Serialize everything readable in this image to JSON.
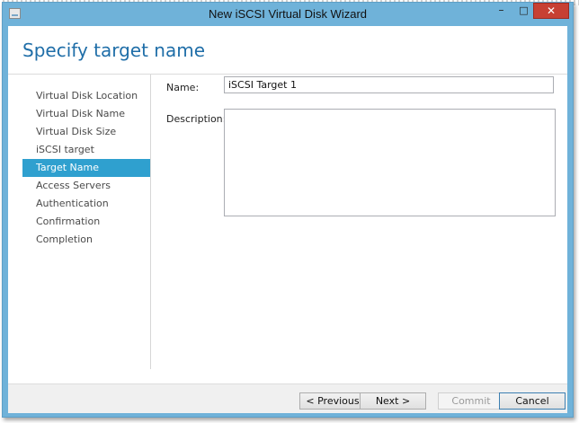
{
  "window": {
    "title": "New iSCSI Virtual Disk Wizard",
    "controls": {
      "minimize": "–",
      "maximize": "□",
      "close": "✕"
    }
  },
  "page": {
    "title": "Specify target name"
  },
  "nav": {
    "items": [
      {
        "label": "Virtual Disk Location",
        "active": false
      },
      {
        "label": "Virtual Disk Name",
        "active": false
      },
      {
        "label": "Virtual Disk Size",
        "active": false
      },
      {
        "label": "iSCSI target",
        "active": false
      },
      {
        "label": "Target Name",
        "active": true
      },
      {
        "label": "Access Servers",
        "active": false
      },
      {
        "label": "Authentication",
        "active": false
      },
      {
        "label": "Confirmation",
        "active": false
      },
      {
        "label": "Completion",
        "active": false
      }
    ]
  },
  "form": {
    "name_label": "Name:",
    "name_value": "iSCSI Target 1",
    "description_label": "Description:",
    "description_value": ""
  },
  "footer": {
    "previous": "< Previous",
    "next": "Next >",
    "commit": "Commit",
    "cancel": "Cancel",
    "commit_enabled": false
  },
  "colors": {
    "accent": "#2fa0cf",
    "title": "#1f6ea8",
    "frame": "#6fb2d9",
    "close": "#c74033"
  },
  "icons": [
    "app-icon",
    "minimize-icon",
    "maximize-icon",
    "close-icon"
  ]
}
